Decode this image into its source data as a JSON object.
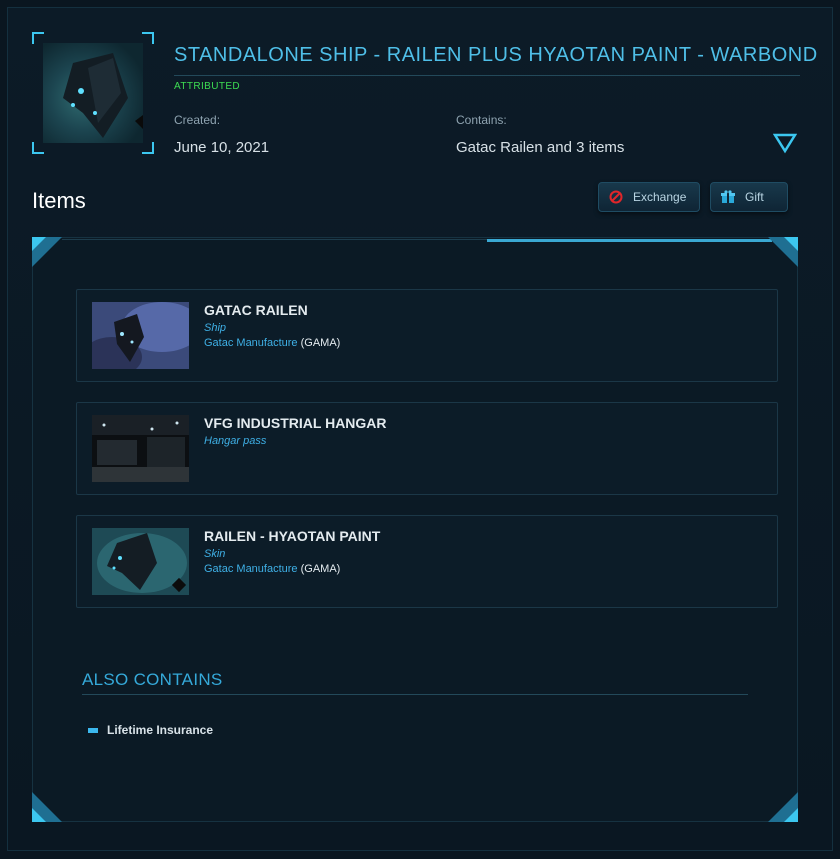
{
  "pledge": {
    "title": "STANDALONE SHIP - RAILEN PLUS HYAOTAN PAINT - WARBOND",
    "status": "ATTRIBUTED",
    "created_label": "Created:",
    "created_value": "June 10, 2021",
    "contains_label": "Contains:",
    "contains_value": "Gatac Railen and 3 items"
  },
  "items_section": {
    "title": "Items",
    "exchange_label": "Exchange",
    "gift_label": "Gift"
  },
  "items": [
    {
      "name": "GATAC RAILEN",
      "type": "Ship",
      "manufacturer": "Gatac Manufacture",
      "code": "(GAMA)"
    },
    {
      "name": "VFG INDUSTRIAL HANGAR",
      "type": "Hangar pass"
    },
    {
      "name": "RAILEN - HYAOTAN PAINT",
      "type": "Skin",
      "manufacturer": "Gatac Manufacture",
      "code": "(GAMA)"
    }
  ],
  "also_contains": {
    "title": "ALSO CONTAINS",
    "entries": [
      "Lifetime Insurance"
    ]
  },
  "colors": {
    "accent": "#4fbfe8",
    "status": "#3ddc52",
    "background": "#0a1620"
  }
}
